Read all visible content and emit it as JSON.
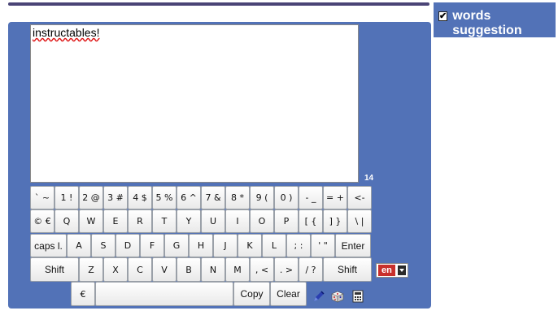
{
  "top_bar_color": "#4a4476",
  "panel_color": "#5272b7",
  "editor": {
    "text": "instructables!",
    "char_count": "14"
  },
  "keyboard": {
    "row1": [
      "` ~",
      "1 !",
      "2 @",
      "3 #",
      "4 $",
      "5 %",
      "6 ^",
      "7 &",
      "8 *",
      "9 (",
      "0 )",
      "- _",
      "= +",
      "<-"
    ],
    "row2": [
      "© €",
      "Q",
      "W",
      "E",
      "R",
      "T",
      "Y",
      "U",
      "I",
      "O",
      "P",
      "[ {",
      "] }",
      "\\ |"
    ],
    "row3": [
      "caps l.",
      "A",
      "S",
      "D",
      "F",
      "G",
      "H",
      "J",
      "K",
      "L",
      "; :",
      "' \"",
      "Enter"
    ],
    "row4": [
      "Shift",
      "Z",
      "X",
      "C",
      "V",
      "B",
      "N",
      "M",
      ", <",
      ". >",
      "/ ?",
      "Shift"
    ],
    "row5": {
      "euro": "€",
      "space": "",
      "copy": "Copy",
      "clear": "Clear"
    }
  },
  "language": {
    "code": "en"
  },
  "toolbar_icons": [
    "pen-icon",
    "dice-icon",
    "calculator-icon"
  ],
  "suggestion": {
    "label": "words suggestion",
    "checked": true,
    "checkmark": "✔"
  }
}
